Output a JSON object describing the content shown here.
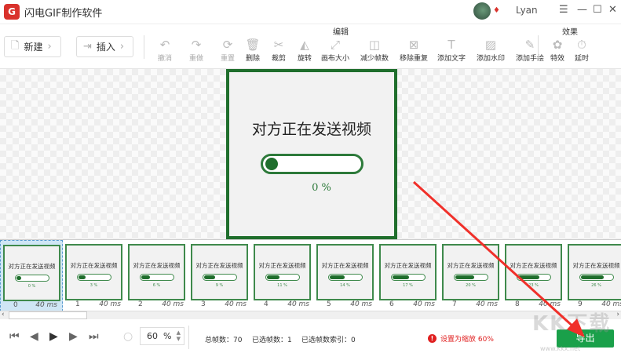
{
  "app": {
    "title": "闪电GIF制作软件",
    "user": "Lyan"
  },
  "toolbar": {
    "new_label": "新建",
    "insert_label": "插入",
    "group_edit": "编辑",
    "group_effects": "效果",
    "tools": [
      {
        "label": "撤消",
        "icon": "undo-icon",
        "disabled": true
      },
      {
        "label": "重做",
        "icon": "redo-icon",
        "disabled": true
      },
      {
        "label": "重置",
        "icon": "reset-icon",
        "disabled": true
      },
      {
        "label": "删除",
        "icon": "trash-icon",
        "disabled": false
      },
      {
        "label": "裁剪",
        "icon": "scissors-icon",
        "disabled": false
      },
      {
        "label": "旋转",
        "icon": "flip-icon",
        "disabled": false
      },
      {
        "label": "画布大小",
        "icon": "resize-icon",
        "disabled": false
      },
      {
        "label": "减少帧数",
        "icon": "reduce-frames-icon",
        "disabled": false
      },
      {
        "label": "移除重复",
        "icon": "remove-duplicate-icon",
        "disabled": false
      },
      {
        "label": "添加文字",
        "icon": "text-icon",
        "disabled": false
      },
      {
        "label": "添加水印",
        "icon": "watermark-icon",
        "disabled": false
      },
      {
        "label": "添加手绘",
        "icon": "pencil-icon",
        "disabled": false
      }
    ],
    "effects": [
      {
        "label": "特效",
        "icon": "effects-icon"
      },
      {
        "label": "延时",
        "icon": "timer-icon"
      }
    ]
  },
  "preview": {
    "title": "对方正在发送视频",
    "percent": "0  %"
  },
  "frames": [
    {
      "index": "0",
      "ms": "40 ms",
      "title": "对方正在发送视频",
      "pct": "0 %",
      "progress": 0
    },
    {
      "index": "1",
      "ms": "40 ms",
      "title": "对方正在发送视频",
      "pct": "3 %",
      "progress": 3
    },
    {
      "index": "2",
      "ms": "40 ms",
      "title": "对方正在发送视频",
      "pct": "6 %",
      "progress": 6
    },
    {
      "index": "3",
      "ms": "40 ms",
      "title": "对方正在发送视频",
      "pct": "9 %",
      "progress": 9
    },
    {
      "index": "4",
      "ms": "40 ms",
      "title": "对方正在发送视频",
      "pct": "11 %",
      "progress": 11
    },
    {
      "index": "5",
      "ms": "40 ms",
      "title": "对方正在发送视频",
      "pct": "14 %",
      "progress": 14
    },
    {
      "index": "6",
      "ms": "40 ms",
      "title": "对方正在发送视频",
      "pct": "17 %",
      "progress": 17
    },
    {
      "index": "7",
      "ms": "40 ms",
      "title": "对方正在发送视频",
      "pct": "20 %",
      "progress": 20
    },
    {
      "index": "8",
      "ms": "40 ms",
      "title": "对方正在发送视频",
      "pct": "23 %",
      "progress": 23
    },
    {
      "index": "9",
      "ms": "40 ms",
      "title": "对方正在发送视频",
      "pct": "26 %",
      "progress": 26
    }
  ],
  "bottom": {
    "zoom": "60",
    "zoom_unit": "%",
    "total_frames": "总帧数：70",
    "selected_frames": "已选帧数：1",
    "selected_index": "已选帧数索引：0",
    "warning": "设置为缩放 60%",
    "export_label": "导出"
  },
  "watermark": {
    "text": "KK下载",
    "url": "www.kkx.net"
  }
}
